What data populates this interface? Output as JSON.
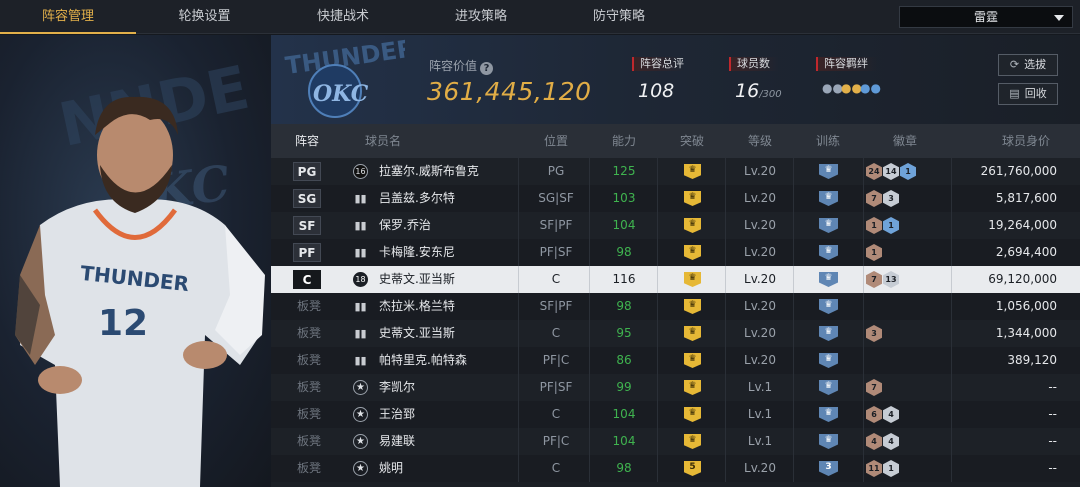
{
  "nav": {
    "tabs": [
      "阵容管理",
      "轮换设置",
      "快捷战术",
      "进攻策略",
      "防守策略"
    ],
    "active_index": 0,
    "team_select": "雷霆"
  },
  "header": {
    "value_label": "阵容价值",
    "value": "361,445,120",
    "stats": {
      "rating_label": "阵容总评",
      "rating": "108",
      "count_label": "球员数",
      "count": "16",
      "count_max": "/300",
      "bond_label": "阵容羁绊"
    },
    "buttons": {
      "pick": "选拔",
      "recycle": "回收"
    }
  },
  "table": {
    "headers": [
      "阵容",
      "球员名",
      "位置",
      "能力",
      "突破",
      "等级",
      "训练",
      "徽章",
      "球员身价"
    ],
    "rows": [
      {
        "slot": "PG",
        "rank_icon": "16",
        "name": "拉塞尔.威斯布鲁克",
        "pos": "PG",
        "ability": "125",
        "breakthrough": "",
        "level": "Lv.20",
        "training": "",
        "badges": [
          [
            "bronze",
            "24"
          ],
          [
            "silver",
            "14"
          ],
          [
            "blue",
            "1"
          ]
        ],
        "worth": "261,760,000"
      },
      {
        "slot": "SG",
        "rank_icon": "bars",
        "name": "吕盖兹.多尔特",
        "pos": "SG|SF",
        "ability": "103",
        "breakthrough": "",
        "level": "Lv.20",
        "training": "",
        "badges": [
          [
            "bronze",
            "7"
          ],
          [
            "silver",
            "3"
          ]
        ],
        "worth": "5,817,600"
      },
      {
        "slot": "SF",
        "rank_icon": "bars",
        "name": "保罗.乔治",
        "pos": "SF|PF",
        "ability": "104",
        "breakthrough": "",
        "level": "Lv.20",
        "training": "",
        "badges": [
          [
            "bronze",
            "1"
          ],
          [
            "blue",
            "1"
          ]
        ],
        "worth": "19,264,000"
      },
      {
        "slot": "PF",
        "rank_icon": "bars",
        "name": "卡梅隆.安东尼",
        "pos": "PF|SF",
        "ability": "98",
        "breakthrough": "",
        "level": "Lv.20",
        "training": "",
        "badges": [
          [
            "bronze",
            "1"
          ]
        ],
        "worth": "2,694,400"
      },
      {
        "slot": "C",
        "rank_icon": "18",
        "name": "史蒂文.亚当斯",
        "pos": "C",
        "ability": "116",
        "breakthrough": "",
        "level": "Lv.20",
        "training": "",
        "badges": [
          [
            "bronze",
            "7"
          ],
          [
            "silver",
            "13"
          ]
        ],
        "worth": "69,120,000"
      },
      {
        "slot": "板凳",
        "rank_icon": "bars",
        "name": "杰拉米.格兰特",
        "pos": "SF|PF",
        "ability": "98",
        "breakthrough": "",
        "level": "Lv.20",
        "training": "",
        "badges": [],
        "worth": "1,056,000"
      },
      {
        "slot": "板凳",
        "rank_icon": "bars",
        "name": "史蒂文.亚当斯",
        "pos": "C",
        "ability": "95",
        "breakthrough": "",
        "level": "Lv.20",
        "training": "",
        "badges": [
          [
            "bronze",
            "3"
          ]
        ],
        "worth": "1,344,000"
      },
      {
        "slot": "板凳",
        "rank_icon": "bars",
        "name": "帕特里克.帕特森",
        "pos": "PF|C",
        "ability": "86",
        "breakthrough": "",
        "level": "Lv.20",
        "training": "",
        "badges": [],
        "worth": "389,120"
      },
      {
        "slot": "板凳",
        "rank_icon": "star",
        "name": "李凯尔",
        "pos": "PF|SF",
        "ability": "99",
        "breakthrough": "",
        "level": "Lv.1",
        "training": "",
        "badges": [
          [
            "bronze",
            "7"
          ]
        ],
        "worth": "--"
      },
      {
        "slot": "板凳",
        "rank_icon": "star",
        "name": "王治郅",
        "pos": "C",
        "ability": "104",
        "breakthrough": "",
        "level": "Lv.1",
        "training": "",
        "badges": [
          [
            "bronze",
            "6"
          ],
          [
            "silver",
            "4"
          ]
        ],
        "worth": "--"
      },
      {
        "slot": "板凳",
        "rank_icon": "star",
        "name": "易建联",
        "pos": "PF|C",
        "ability": "104",
        "breakthrough": "",
        "level": "Lv.1",
        "training": "",
        "badges": [
          [
            "bronze",
            "4"
          ],
          [
            "silver",
            "4"
          ]
        ],
        "worth": "--"
      },
      {
        "slot": "板凳",
        "rank_icon": "star",
        "name": "姚明",
        "pos": "C",
        "ability": "98",
        "breakthrough": "5",
        "level": "Lv.20",
        "training": "3",
        "badges": [
          [
            "bronze",
            "11"
          ],
          [
            "silver",
            "1"
          ]
        ],
        "worth": "--"
      }
    ],
    "selected_index": 4
  },
  "colors": {
    "accent": "#e2b04a",
    "ability_green": "#3fb34f",
    "stat_red": "#c0282d"
  }
}
